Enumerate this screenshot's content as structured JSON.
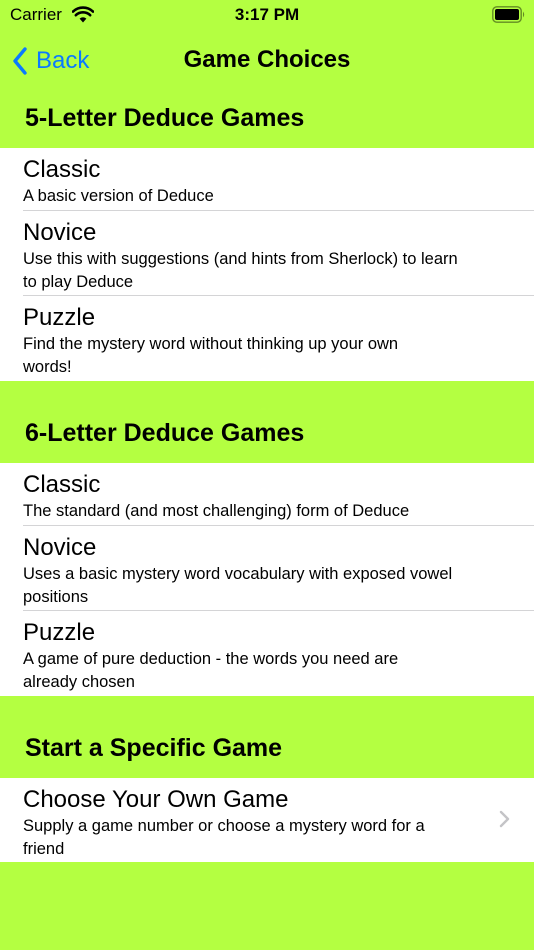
{
  "status_bar": {
    "carrier": "Carrier",
    "time": "3:17 PM"
  },
  "nav": {
    "back_label": "Back",
    "title": "Game Choices"
  },
  "sections": [
    {
      "title": "5-Letter Deduce Games",
      "rows": [
        {
          "title": "Classic",
          "subtitle": "A basic version of Deduce"
        },
        {
          "title": "Novice",
          "subtitle": "Use this with suggestions (and hints from Sherlock) to learn to play Deduce"
        },
        {
          "title": "Puzzle",
          "subtitle": "Find the mystery word without thinking up your own words!"
        }
      ]
    },
    {
      "title": "6-Letter Deduce Games",
      "rows": [
        {
          "title": "Classic",
          "subtitle": "The standard (and most challenging) form of Deduce"
        },
        {
          "title": "Novice",
          "subtitle": "Uses a basic mystery word vocabulary with exposed vowel positions"
        },
        {
          "title": "Puzzle",
          "subtitle": "A game of pure deduction - the words you need are already chosen"
        }
      ]
    },
    {
      "title": "Start a Specific Game",
      "rows": [
        {
          "title": "Choose Your Own Game",
          "subtitle": "Supply a game number or choose a mystery word for a friend"
        }
      ]
    }
  ],
  "colors": {
    "background": "#b4ff41",
    "accent": "#0a7aff",
    "separator": "#d4d4d6"
  }
}
